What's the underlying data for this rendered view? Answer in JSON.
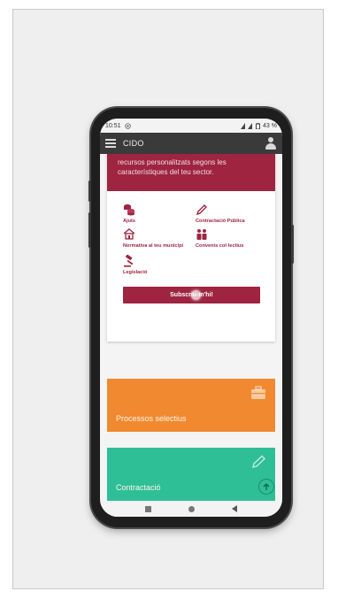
{
  "status_bar": {
    "time": "10:51",
    "battery": "43 %"
  },
  "app_bar": {
    "title": "CIDO"
  },
  "subscription_card": {
    "description": "recursos personalitzats segons les característiques del teu sector.",
    "categories": [
      {
        "label": "Ajuts",
        "icon": "coins-icon"
      },
      {
        "label": "Contractació Pública",
        "icon": "pencil-icon"
      },
      {
        "label": "Normativa al teu municipi",
        "icon": "town-hall-icon"
      },
      {
        "label": "Convenis col·lectius",
        "icon": "people-icon"
      },
      {
        "label": "Legislació",
        "icon": "gavel-icon"
      }
    ],
    "subscribe_label": "Subscriu-m'hi!"
  },
  "tiles": [
    {
      "label": "Processos selectius",
      "icon": "briefcase-icon",
      "color": "#f0892f"
    },
    {
      "label": "Contractació",
      "icon": "pencil-icon",
      "color": "#2fbf97"
    }
  ],
  "colors": {
    "brand": "#9e2440",
    "app_bar": "#3a3a3a"
  }
}
